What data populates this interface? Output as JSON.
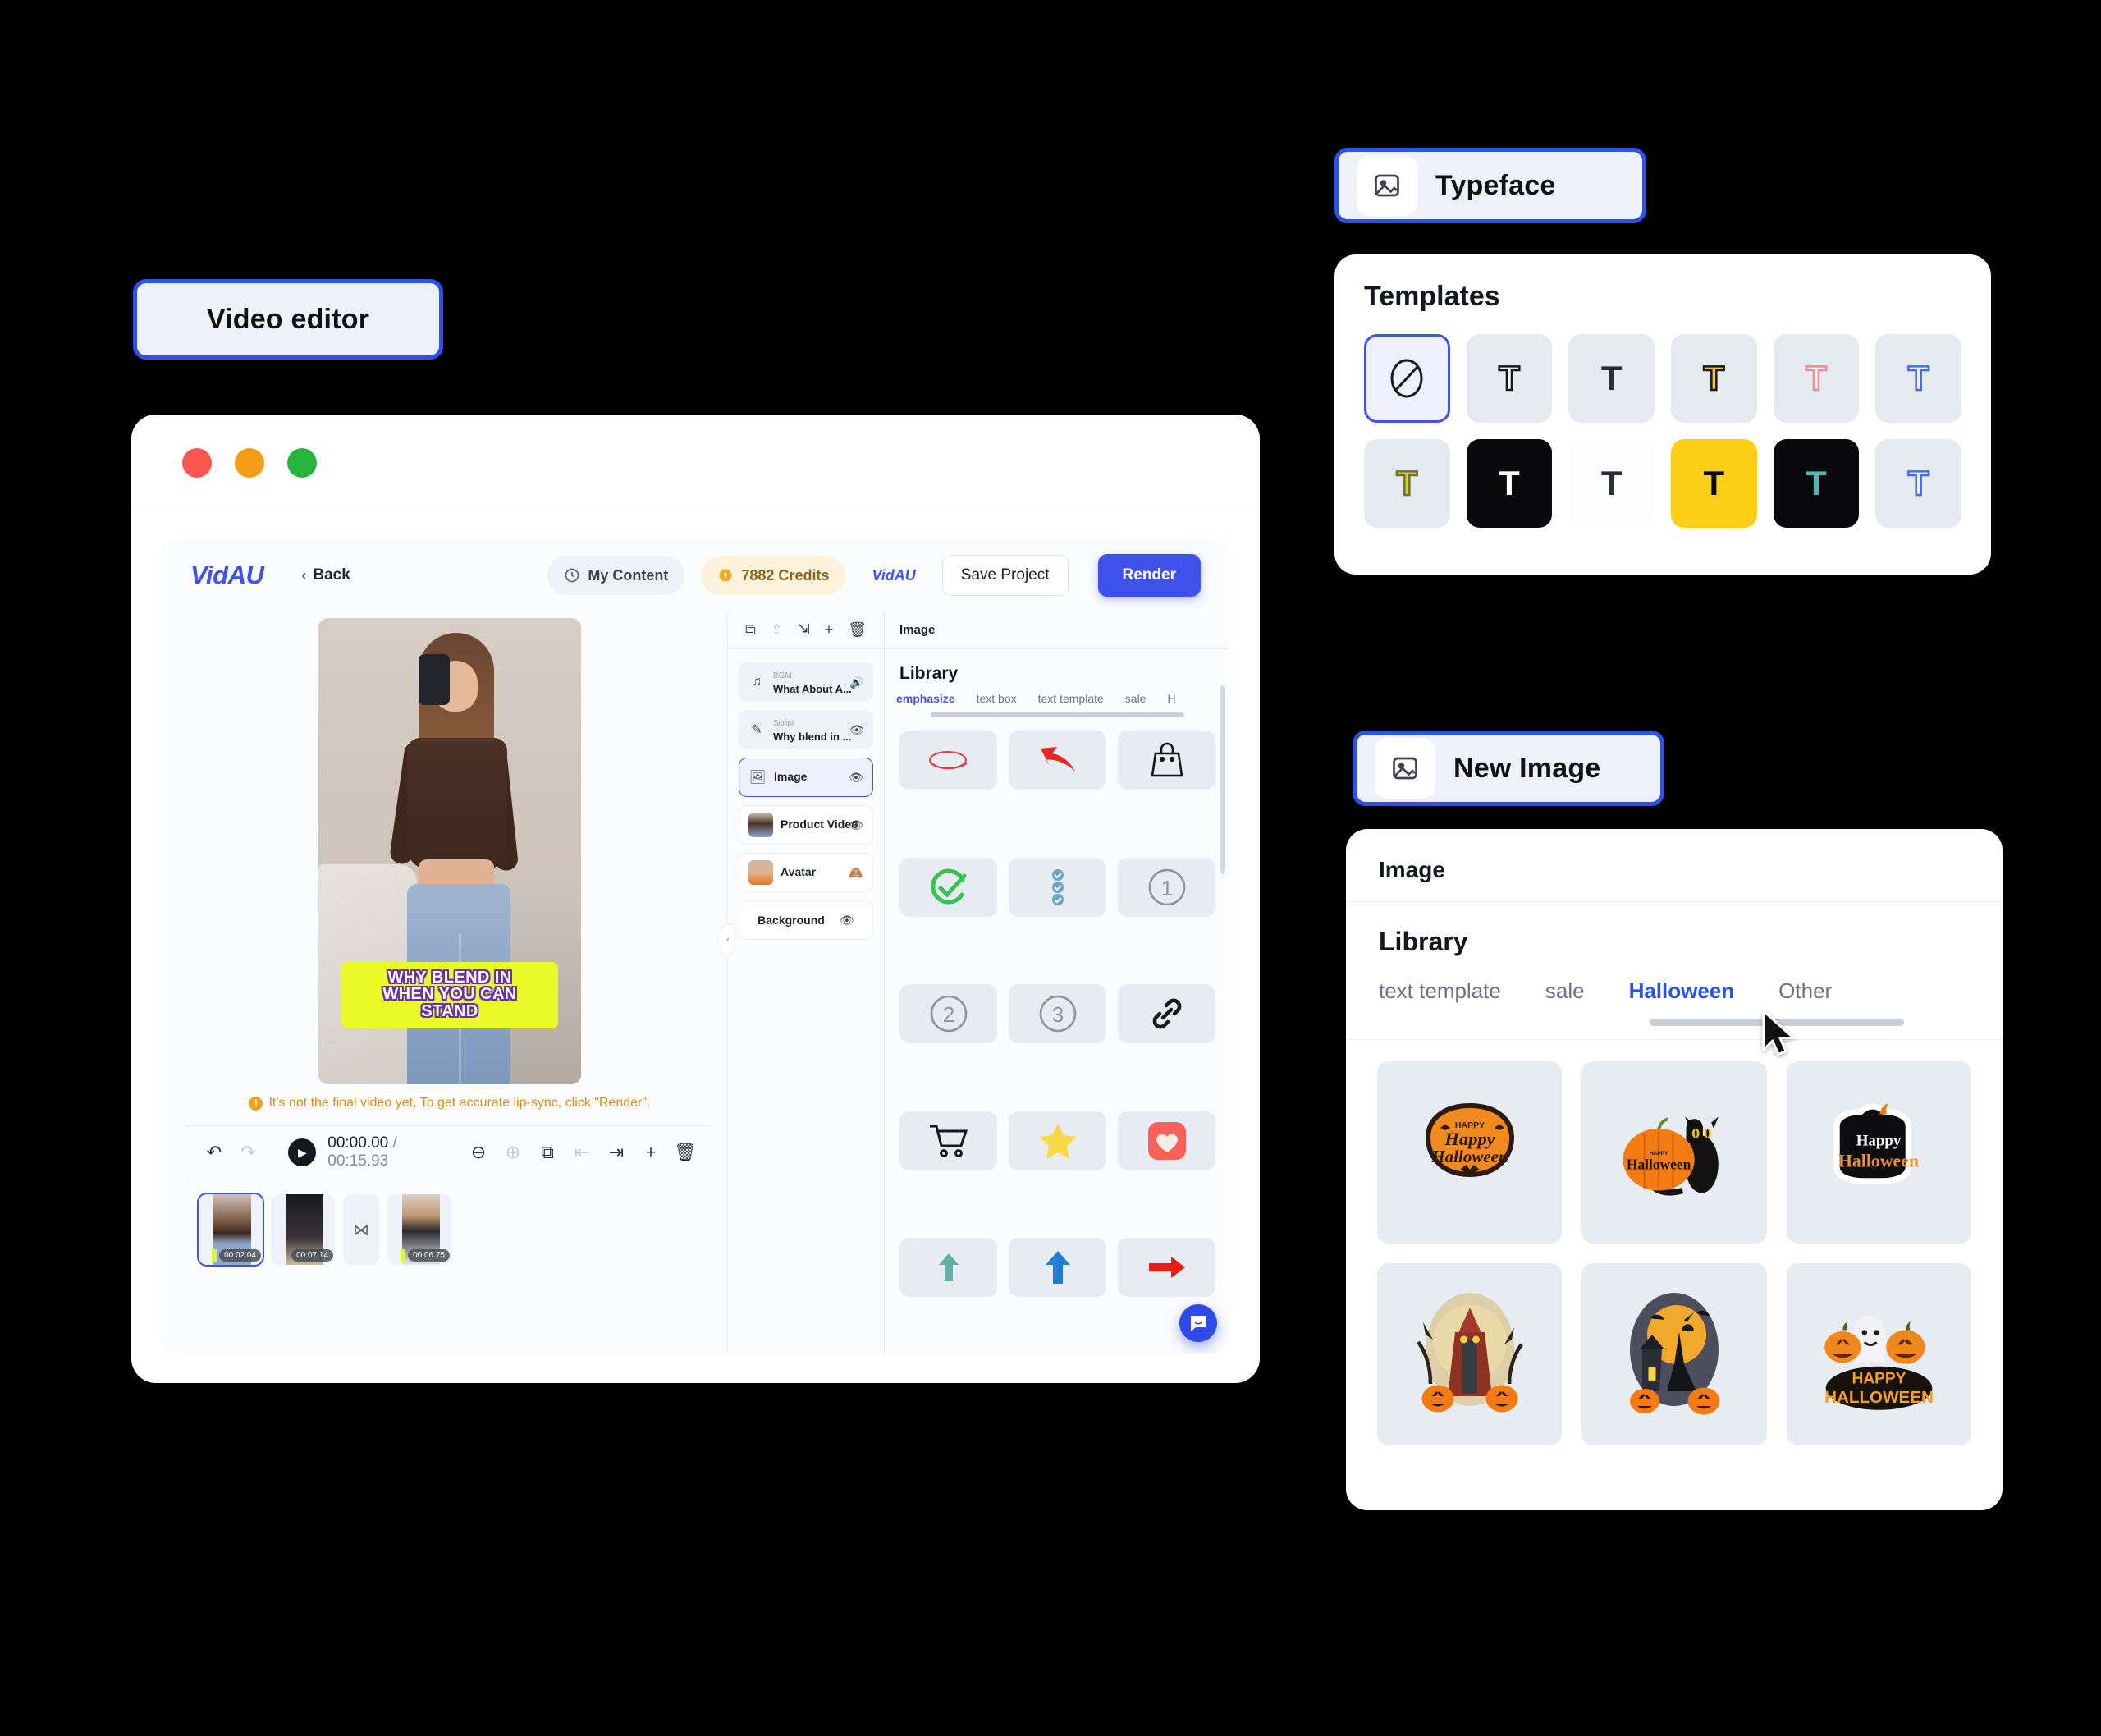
{
  "callouts": {
    "video_editor": "Video editor",
    "typeface": "Typeface",
    "new_image": "New Image"
  },
  "editor": {
    "brand": "VidAU",
    "back_label": "Back",
    "my_content_label": "My Content",
    "credits_label": "7882 Credits",
    "mini_brand": "VidAU",
    "save_label": "Save Project",
    "render_label": "Render",
    "preview": {
      "caption_lines": [
        "WHY BLEND IN",
        "WHEN YOU CAN",
        "STAND"
      ],
      "notice": "It's not the final video yet, To get accurate lip-sync, click \"Render\"."
    },
    "timeline": {
      "current_time": "00:00.00",
      "separator": " / ",
      "total_time": "00:15.93",
      "clips": [
        {
          "stamp": "00:02.04",
          "selected": true
        },
        {
          "stamp": "00:07.14",
          "selected": false
        },
        {
          "stamp": "",
          "selected": false,
          "is_gap": true
        },
        {
          "stamp": "00:06.75",
          "selected": false
        }
      ]
    },
    "layers": [
      {
        "sub": "BGM",
        "title": "What About A...",
        "eye": "speaker",
        "kind": "icon",
        "icon": "music-note",
        "state": "normal"
      },
      {
        "sub": "Script",
        "title": "Why blend in ...",
        "eye": "visible",
        "kind": "icon",
        "icon": "script",
        "state": "normal"
      },
      {
        "sub": "",
        "title": "Image",
        "eye": "visible",
        "kind": "icon",
        "icon": "image",
        "state": "active"
      },
      {
        "sub": "",
        "title": "Product Video",
        "eye": "visible",
        "kind": "thumb",
        "state": "card"
      },
      {
        "sub": "",
        "title": "Avatar",
        "eye": "hidden",
        "kind": "thumb",
        "state": "card"
      },
      {
        "sub": "",
        "title": "Background",
        "eye": "visible",
        "kind": "none",
        "state": "card"
      }
    ],
    "library": {
      "header": "Image",
      "title": "Library",
      "tabs": [
        {
          "label": "emphasize",
          "active": true
        },
        {
          "label": "text box",
          "active": false
        },
        {
          "label": "text template",
          "active": false
        },
        {
          "label": "sale",
          "active": false
        },
        {
          "label": "H",
          "active": false
        }
      ],
      "icons": [
        "red-scribble-circle",
        "red-curved-arrow",
        "shopping-bag",
        "green-check-circle",
        "blue-checklist",
        "circled-number-1",
        "circled-number-2",
        "circled-number-3",
        "link-chain",
        "shopping-cart",
        "yellow-star",
        "red-heart-square",
        "teal-up-arrow",
        "blue-up-arrow",
        "red-right-arrow"
      ]
    }
  },
  "templates_panel": {
    "title": "Templates",
    "items": [
      {
        "glyph": "⊘",
        "style": "none",
        "selected": true
      },
      {
        "glyph": "T",
        "style": "outline-dark",
        "selected": false
      },
      {
        "glyph": "T",
        "style": "plain-dark",
        "selected": false
      },
      {
        "glyph": "T",
        "style": "yellow-fill",
        "selected": false
      },
      {
        "glyph": "T",
        "style": "pink-outline",
        "selected": false
      },
      {
        "glyph": "T",
        "style": "blue-outline",
        "selected": false
      },
      {
        "glyph": "T",
        "style": "olive-fill",
        "selected": false
      },
      {
        "glyph": "T",
        "style": "black-bg-white",
        "selected": false
      },
      {
        "glyph": "T",
        "style": "white-bg-dark",
        "selected": false
      },
      {
        "glyph": "T",
        "style": "yellow-bg-black",
        "selected": false
      },
      {
        "glyph": "T",
        "style": "black-bg-teal",
        "selected": false
      },
      {
        "glyph": "T",
        "style": "blue-outline-2",
        "selected": false
      }
    ]
  },
  "image_panel": {
    "header": "Image",
    "library_title": "Library",
    "tabs": [
      {
        "label": "text template",
        "active": false
      },
      {
        "label": "sale",
        "active": false
      },
      {
        "label": "Halloween",
        "active": true
      },
      {
        "label": "Other",
        "active": false
      }
    ],
    "thumbnails": [
      "happy-halloween-orange-badge",
      "pumpkin-with-black-cat",
      "happy-halloween-black-badge",
      "scarecrow-with-pumpkins",
      "witch-moon-haunted-house",
      "happy-halloween-ghost-pumpkins"
    ]
  },
  "colors": {
    "accent": "#3f52ec",
    "callout_border": "#2b52ec",
    "credits_bg": "#fdf2dc",
    "caption_bg": "#e9fa27",
    "notice": "#e9890d"
  }
}
